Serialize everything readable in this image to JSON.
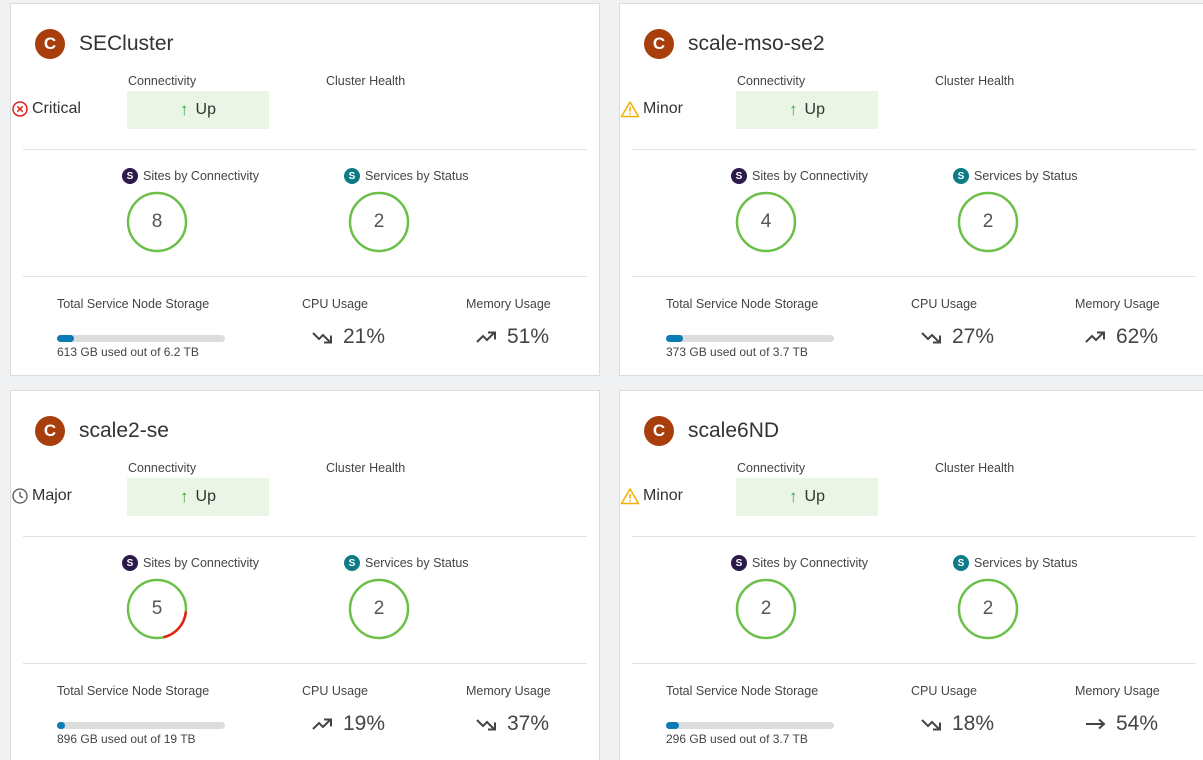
{
  "labels": {
    "connectivity": "Connectivity",
    "cluster_health": "Cluster Health",
    "sites_by_connectivity": "Sites by Connectivity",
    "services_by_status": "Services by Status",
    "total_storage": "Total Service Node Storage",
    "cpu_usage": "CPU Usage",
    "memory_usage": "Memory Usage"
  },
  "colors": {
    "avatar": "#a83e0c",
    "ring_ok": "#6cc04a",
    "ring_bad": "#e2231a",
    "bar_fill": "#0b7bb5",
    "badge_sites": "#2b1a4a",
    "badge_services": "#0e7c86"
  },
  "clusters": [
    {
      "avatar_letter": "C",
      "name": "SECluster",
      "connectivity": "Up",
      "health": "Critical",
      "health_icon": "critical-icon",
      "sites_badge": "S",
      "sites_count": "8",
      "sites_ok_fraction": 1.0,
      "services_badge": "S",
      "services_count": "2",
      "services_ok_fraction": 1.0,
      "storage_fraction": 0.1,
      "storage_text": "613 GB used out of 6.2 TB",
      "cpu": "21%",
      "cpu_trend": "trend-down-icon",
      "memory": "51%",
      "memory_trend": "trend-up-icon"
    },
    {
      "avatar_letter": "C",
      "name": "scale-mso-se2",
      "connectivity": "Up",
      "health": "Minor",
      "health_icon": "warning-icon",
      "sites_badge": "S",
      "sites_count": "4",
      "sites_ok_fraction": 1.0,
      "services_badge": "S",
      "services_count": "2",
      "services_ok_fraction": 1.0,
      "storage_fraction": 0.1,
      "storage_text": "373 GB used out of 3.7 TB",
      "cpu": "27%",
      "cpu_trend": "trend-down-icon",
      "memory": "62%",
      "memory_trend": "trend-up-icon"
    },
    {
      "avatar_letter": "C",
      "name": "scale2-se",
      "connectivity": "Up",
      "health": "Major",
      "health_icon": "clock-icon",
      "sites_badge": "S",
      "sites_count": "5",
      "sites_ok_fraction": 0.8,
      "services_badge": "S",
      "services_count": "2",
      "services_ok_fraction": 1.0,
      "storage_fraction": 0.05,
      "storage_text": "896 GB used out of 19 TB",
      "cpu": "19%",
      "cpu_trend": "trend-up-icon",
      "memory": "37%",
      "memory_trend": "trend-down-icon"
    },
    {
      "avatar_letter": "C",
      "name": "scale6ND",
      "connectivity": "Up",
      "health": "Minor",
      "health_icon": "warning-icon",
      "sites_badge": "S",
      "sites_count": "2",
      "sites_ok_fraction": 1.0,
      "services_badge": "S",
      "services_count": "2",
      "services_ok_fraction": 1.0,
      "storage_fraction": 0.08,
      "storage_text": "296 GB used out of 3.7 TB",
      "cpu": "18%",
      "cpu_trend": "trend-down-icon",
      "memory": "54%",
      "memory_trend": "trend-flat-icon"
    }
  ]
}
